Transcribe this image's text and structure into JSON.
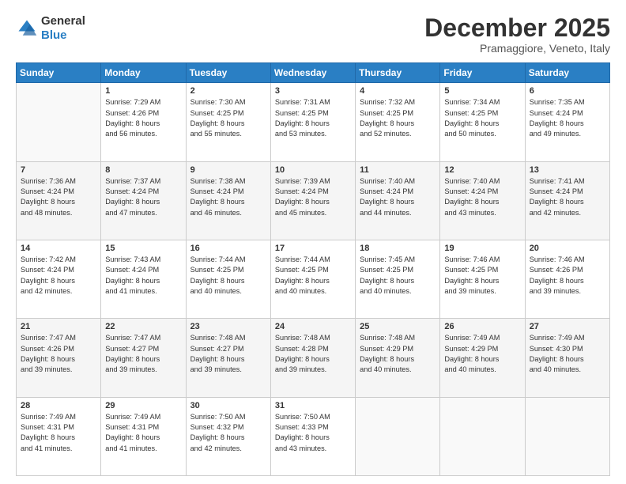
{
  "header": {
    "logo_line1": "General",
    "logo_line2": "Blue",
    "month": "December 2025",
    "location": "Pramaggiore, Veneto, Italy"
  },
  "days_of_week": [
    "Sunday",
    "Monday",
    "Tuesday",
    "Wednesday",
    "Thursday",
    "Friday",
    "Saturday"
  ],
  "weeks": [
    [
      {
        "day": "",
        "info": ""
      },
      {
        "day": "1",
        "info": "Sunrise: 7:29 AM\nSunset: 4:26 PM\nDaylight: 8 hours\nand 56 minutes."
      },
      {
        "day": "2",
        "info": "Sunrise: 7:30 AM\nSunset: 4:25 PM\nDaylight: 8 hours\nand 55 minutes."
      },
      {
        "day": "3",
        "info": "Sunrise: 7:31 AM\nSunset: 4:25 PM\nDaylight: 8 hours\nand 53 minutes."
      },
      {
        "day": "4",
        "info": "Sunrise: 7:32 AM\nSunset: 4:25 PM\nDaylight: 8 hours\nand 52 minutes."
      },
      {
        "day": "5",
        "info": "Sunrise: 7:34 AM\nSunset: 4:25 PM\nDaylight: 8 hours\nand 50 minutes."
      },
      {
        "day": "6",
        "info": "Sunrise: 7:35 AM\nSunset: 4:24 PM\nDaylight: 8 hours\nand 49 minutes."
      }
    ],
    [
      {
        "day": "7",
        "info": "Sunrise: 7:36 AM\nSunset: 4:24 PM\nDaylight: 8 hours\nand 48 minutes."
      },
      {
        "day": "8",
        "info": "Sunrise: 7:37 AM\nSunset: 4:24 PM\nDaylight: 8 hours\nand 47 minutes."
      },
      {
        "day": "9",
        "info": "Sunrise: 7:38 AM\nSunset: 4:24 PM\nDaylight: 8 hours\nand 46 minutes."
      },
      {
        "day": "10",
        "info": "Sunrise: 7:39 AM\nSunset: 4:24 PM\nDaylight: 8 hours\nand 45 minutes."
      },
      {
        "day": "11",
        "info": "Sunrise: 7:40 AM\nSunset: 4:24 PM\nDaylight: 8 hours\nand 44 minutes."
      },
      {
        "day": "12",
        "info": "Sunrise: 7:40 AM\nSunset: 4:24 PM\nDaylight: 8 hours\nand 43 minutes."
      },
      {
        "day": "13",
        "info": "Sunrise: 7:41 AM\nSunset: 4:24 PM\nDaylight: 8 hours\nand 42 minutes."
      }
    ],
    [
      {
        "day": "14",
        "info": "Sunrise: 7:42 AM\nSunset: 4:24 PM\nDaylight: 8 hours\nand 42 minutes."
      },
      {
        "day": "15",
        "info": "Sunrise: 7:43 AM\nSunset: 4:24 PM\nDaylight: 8 hours\nand 41 minutes."
      },
      {
        "day": "16",
        "info": "Sunrise: 7:44 AM\nSunset: 4:25 PM\nDaylight: 8 hours\nand 40 minutes."
      },
      {
        "day": "17",
        "info": "Sunrise: 7:44 AM\nSunset: 4:25 PM\nDaylight: 8 hours\nand 40 minutes."
      },
      {
        "day": "18",
        "info": "Sunrise: 7:45 AM\nSunset: 4:25 PM\nDaylight: 8 hours\nand 40 minutes."
      },
      {
        "day": "19",
        "info": "Sunrise: 7:46 AM\nSunset: 4:25 PM\nDaylight: 8 hours\nand 39 minutes."
      },
      {
        "day": "20",
        "info": "Sunrise: 7:46 AM\nSunset: 4:26 PM\nDaylight: 8 hours\nand 39 minutes."
      }
    ],
    [
      {
        "day": "21",
        "info": "Sunrise: 7:47 AM\nSunset: 4:26 PM\nDaylight: 8 hours\nand 39 minutes."
      },
      {
        "day": "22",
        "info": "Sunrise: 7:47 AM\nSunset: 4:27 PM\nDaylight: 8 hours\nand 39 minutes."
      },
      {
        "day": "23",
        "info": "Sunrise: 7:48 AM\nSunset: 4:27 PM\nDaylight: 8 hours\nand 39 minutes."
      },
      {
        "day": "24",
        "info": "Sunrise: 7:48 AM\nSunset: 4:28 PM\nDaylight: 8 hours\nand 39 minutes."
      },
      {
        "day": "25",
        "info": "Sunrise: 7:48 AM\nSunset: 4:29 PM\nDaylight: 8 hours\nand 40 minutes."
      },
      {
        "day": "26",
        "info": "Sunrise: 7:49 AM\nSunset: 4:29 PM\nDaylight: 8 hours\nand 40 minutes."
      },
      {
        "day": "27",
        "info": "Sunrise: 7:49 AM\nSunset: 4:30 PM\nDaylight: 8 hours\nand 40 minutes."
      }
    ],
    [
      {
        "day": "28",
        "info": "Sunrise: 7:49 AM\nSunset: 4:31 PM\nDaylight: 8 hours\nand 41 minutes."
      },
      {
        "day": "29",
        "info": "Sunrise: 7:49 AM\nSunset: 4:31 PM\nDaylight: 8 hours\nand 41 minutes."
      },
      {
        "day": "30",
        "info": "Sunrise: 7:50 AM\nSunset: 4:32 PM\nDaylight: 8 hours\nand 42 minutes."
      },
      {
        "day": "31",
        "info": "Sunrise: 7:50 AM\nSunset: 4:33 PM\nDaylight: 8 hours\nand 43 minutes."
      },
      {
        "day": "",
        "info": ""
      },
      {
        "day": "",
        "info": ""
      },
      {
        "day": "",
        "info": ""
      }
    ]
  ]
}
